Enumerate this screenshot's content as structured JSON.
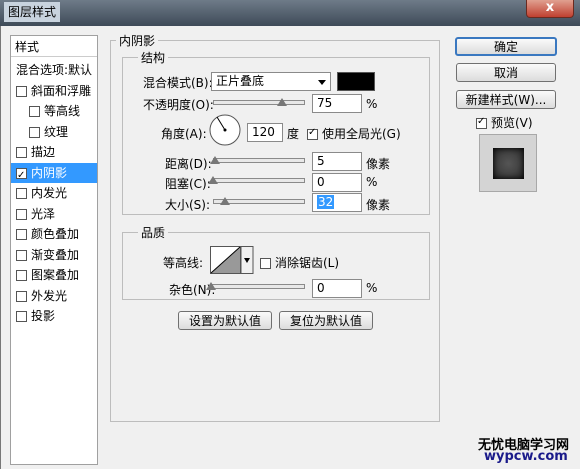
{
  "window": {
    "title": "图层样式",
    "close_label": "x"
  },
  "sidebar": {
    "header": "样式",
    "items": [
      {
        "label": "混合选项:默认",
        "checkbox": false,
        "checked": false,
        "selected": false,
        "indent": false
      },
      {
        "label": "斜面和浮雕",
        "checkbox": true,
        "checked": false,
        "selected": false,
        "indent": false
      },
      {
        "label": "等高线",
        "checkbox": true,
        "checked": false,
        "selected": false,
        "indent": true
      },
      {
        "label": "纹理",
        "checkbox": true,
        "checked": false,
        "selected": false,
        "indent": true
      },
      {
        "label": "描边",
        "checkbox": true,
        "checked": false,
        "selected": false,
        "indent": false
      },
      {
        "label": "内阴影",
        "checkbox": true,
        "checked": true,
        "selected": true,
        "indent": false
      },
      {
        "label": "内发光",
        "checkbox": true,
        "checked": false,
        "selected": false,
        "indent": false
      },
      {
        "label": "光泽",
        "checkbox": true,
        "checked": false,
        "selected": false,
        "indent": false
      },
      {
        "label": "颜色叠加",
        "checkbox": true,
        "checked": false,
        "selected": false,
        "indent": false
      },
      {
        "label": "渐变叠加",
        "checkbox": true,
        "checked": false,
        "selected": false,
        "indent": false
      },
      {
        "label": "图案叠加",
        "checkbox": true,
        "checked": false,
        "selected": false,
        "indent": false
      },
      {
        "label": "外发光",
        "checkbox": true,
        "checked": false,
        "selected": false,
        "indent": false
      },
      {
        "label": "投影",
        "checkbox": true,
        "checked": false,
        "selected": false,
        "indent": false
      }
    ]
  },
  "panel": {
    "title": "内阴影",
    "structure": {
      "title": "结构",
      "blend_label": "混合模式(B):",
      "blend_value": "正片叠底",
      "blend_color": "#000000",
      "opacity_label": "不透明度(O):",
      "opacity_value": "75",
      "opacity_unit": "%",
      "opacity_level": 0.75,
      "angle_label": "角度(A):",
      "angle_value": "120",
      "angle_unit": "度",
      "global_light_label": "使用全局光(G)",
      "global_light_checked": true,
      "distance_label": "距离(D):",
      "distance_value": "5",
      "distance_unit": "像素",
      "distance_level": 0.02,
      "choke_label": "阻塞(C):",
      "choke_value": "0",
      "choke_unit": "%",
      "choke_level": 0.0,
      "size_label": "大小(S):",
      "size_value": "32",
      "size_unit": "像素",
      "size_level": 0.13
    },
    "quality": {
      "title": "品质",
      "contour_label": "等高线:",
      "antialias_label": "消除锯齿(L)",
      "antialias_checked": false,
      "noise_label": "杂色(N):",
      "noise_value": "0",
      "noise_unit": "%",
      "noise_level": 0.0
    },
    "set_default_label": "设置为默认值",
    "reset_default_label": "复位为默认值"
  },
  "buttons": {
    "ok": "确定",
    "cancel": "取消",
    "new_style": "新建样式(W)...",
    "preview_label": "预览(V)",
    "preview_checked": true
  },
  "watermark": {
    "line1": "无忧电脑学习网",
    "line2": "wypcw.com"
  }
}
